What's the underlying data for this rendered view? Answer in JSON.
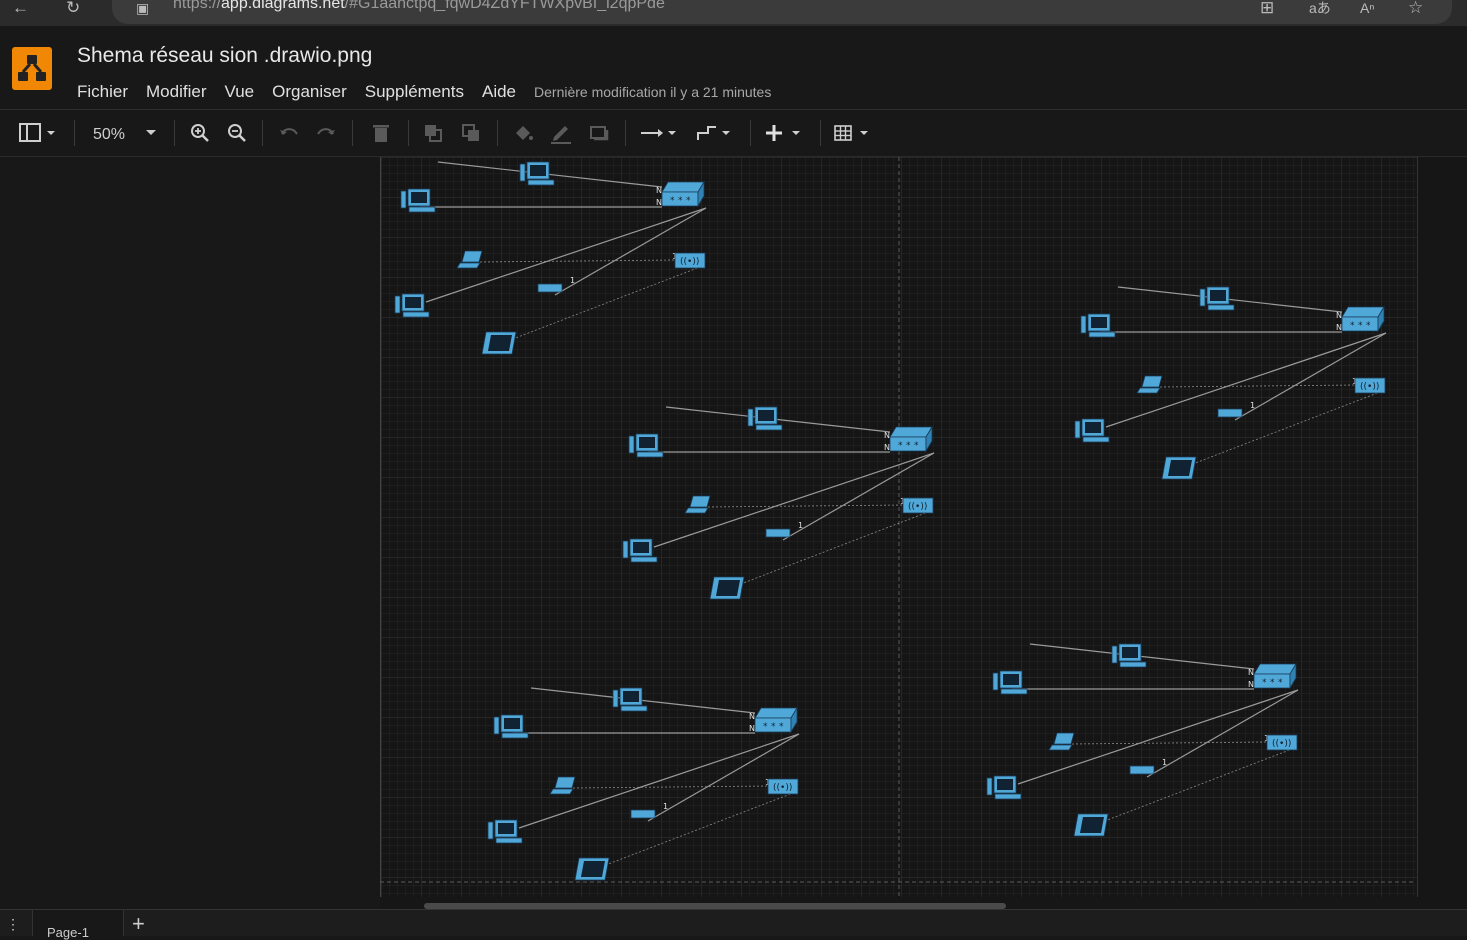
{
  "browser": {
    "url_prefix": "https://",
    "url_domain": "app.diagrams.net",
    "url_rest": "/#G1aanctpq_fqwD4ZdYFTWXpvBI_i2qpPde"
  },
  "app": {
    "title": "Shema réseau sion .drawio.png",
    "menus": [
      "Fichier",
      "Modifier",
      "Vue",
      "Organiser",
      "Suppléments",
      "Aide"
    ],
    "status": "Dernière modification il y a 21 minutes"
  },
  "toolbar": {
    "zoom": "50%"
  },
  "diagram": {
    "port_label": "N",
    "link_label": "1",
    "clusters": 5
  },
  "pages": {
    "tab_label": "Page-1"
  },
  "colors": {
    "accent": "#f08705",
    "device_fill": "#4fa8d8",
    "device_stroke": "#1a3b57"
  }
}
